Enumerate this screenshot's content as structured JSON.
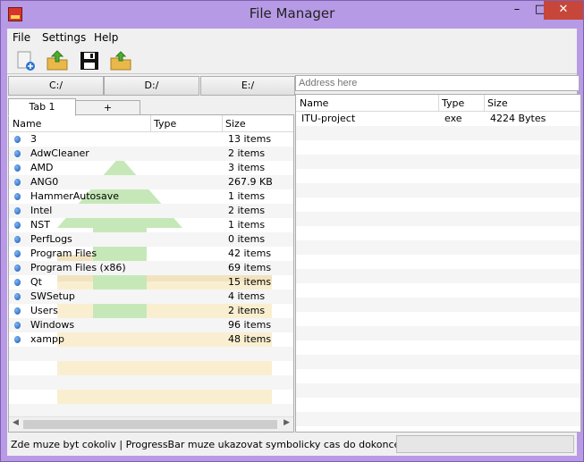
{
  "window": {
    "title": "File Manager",
    "controls": {
      "minimize": "–",
      "maximize": "□",
      "close": "✕"
    }
  },
  "menu": {
    "items": [
      "File",
      "Settings",
      "Help"
    ]
  },
  "toolbar": {
    "buttons": [
      "new-file-icon",
      "folder-up-icon",
      "save-icon",
      "open-folder-icon"
    ]
  },
  "drives": [
    "C:/",
    "D:/",
    "E:/"
  ],
  "address": {
    "placeholder": "Address here",
    "value": ""
  },
  "tabs": [
    {
      "label": "Tab 1",
      "active": true
    },
    {
      "label": "+",
      "active": false
    }
  ],
  "left_table": {
    "headers": [
      "Name",
      "Type",
      "Size"
    ],
    "rows": [
      {
        "name": "3",
        "type": "",
        "size": "13 items"
      },
      {
        "name": "AdwCleaner",
        "type": "",
        "size": "2 items"
      },
      {
        "name": "AMD",
        "type": "",
        "size": "3 items"
      },
      {
        "name": "ANG0",
        "type": "",
        "size": "267.9 KB"
      },
      {
        "name": "HammerAutosave",
        "type": "",
        "size": "1 items"
      },
      {
        "name": "Intel",
        "type": "",
        "size": "2 items"
      },
      {
        "name": "NST",
        "type": "",
        "size": "1 items"
      },
      {
        "name": "PerfLogs",
        "type": "",
        "size": "0 items"
      },
      {
        "name": "Program Files",
        "type": "",
        "size": "42 items"
      },
      {
        "name": "Program Files (x86)",
        "type": "",
        "size": "69 items"
      },
      {
        "name": "Qt",
        "type": "",
        "size": "15 items"
      },
      {
        "name": "SWSetup",
        "type": "",
        "size": "4 items"
      },
      {
        "name": "Users",
        "type": "",
        "size": "2 items"
      },
      {
        "name": "Windows",
        "type": "",
        "size": "96 items"
      },
      {
        "name": "xampp",
        "type": "",
        "size": "48 items"
      }
    ]
  },
  "right_table": {
    "headers": [
      "Name",
      "Type",
      "Size"
    ],
    "rows": [
      {
        "name": "ITU-project",
        "type": "exe",
        "size": "4224 Bytes"
      }
    ]
  },
  "status": {
    "text": "Zde muze byt cokoliv | ProgressBar muze ukazovat symbolicky cas do dokonceni operace",
    "progress": 0
  },
  "colors": {
    "titlebar": "#b79ae5",
    "close": "#c7463a",
    "file_icon": "#1a56b4"
  }
}
